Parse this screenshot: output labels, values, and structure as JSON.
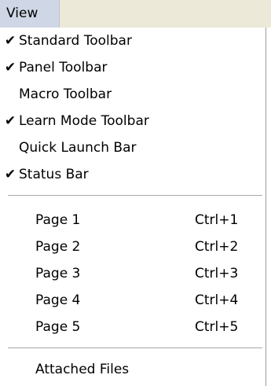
{
  "menu": {
    "title": "View"
  },
  "items": [
    {
      "label": "Standard Toolbar",
      "checked": true
    },
    {
      "label": "Panel Toolbar",
      "checked": true
    },
    {
      "label": "Macro Toolbar",
      "checked": false
    },
    {
      "label": "Learn Mode Toolbar",
      "checked": true
    },
    {
      "label": "Quick Launch Bar",
      "checked": false
    },
    {
      "label": "Status Bar",
      "checked": true
    }
  ],
  "pages": [
    {
      "label": "Page 1",
      "shortcut": "Ctrl+1"
    },
    {
      "label": "Page 2",
      "shortcut": "Ctrl+2"
    },
    {
      "label": "Page 3",
      "shortcut": "Ctrl+3"
    },
    {
      "label": "Page 4",
      "shortcut": "Ctrl+4"
    },
    {
      "label": "Page 5",
      "shortcut": "Ctrl+5"
    }
  ],
  "attached_files": {
    "label": "Attached Files"
  },
  "icons": {
    "check": "✔"
  }
}
